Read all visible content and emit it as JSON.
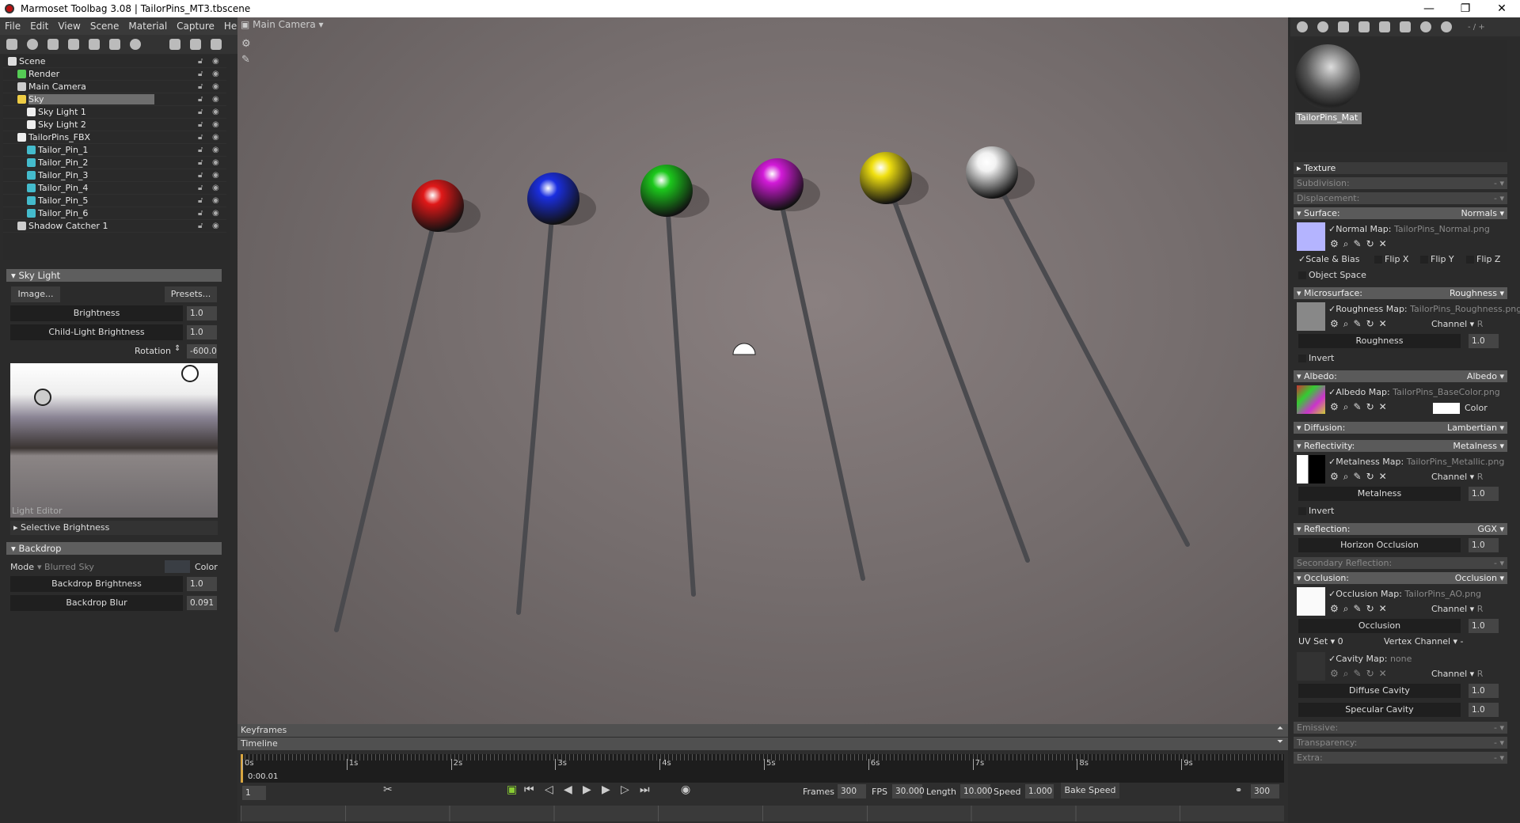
{
  "window": {
    "title": "Marmoset Toolbag 3.08  |  TailorPins_MT3.tbscene",
    "minimize": "—",
    "maximize": "❐",
    "close": "✕"
  },
  "menu": [
    "File",
    "Edit",
    "View",
    "Scene",
    "Material",
    "Capture",
    "Help"
  ],
  "scene_tree": [
    {
      "label": "Scene",
      "icon": "scene-icon",
      "depth": 0
    },
    {
      "label": "Render",
      "icon": "render-gear-icon",
      "depth": 1
    },
    {
      "label": "Main Camera",
      "icon": "camera-icon",
      "depth": 1
    },
    {
      "label": "Sky",
      "icon": "sky-icon",
      "depth": 1,
      "selected": true
    },
    {
      "label": "Sky Light 1",
      "icon": "light-bulb-icon",
      "depth": 2
    },
    {
      "label": "Sky Light 2",
      "icon": "light-bulb-icon",
      "depth": 2
    },
    {
      "label": "TailorPins_FBX",
      "icon": "fbx-icon",
      "depth": 1
    },
    {
      "label": "Tailor_Pin_1",
      "icon": "mesh-cube-icon",
      "depth": 2
    },
    {
      "label": "Tailor_Pin_2",
      "icon": "mesh-cube-icon",
      "depth": 2
    },
    {
      "label": "Tailor_Pin_3",
      "icon": "mesh-cube-icon",
      "depth": 2
    },
    {
      "label": "Tailor_Pin_4",
      "icon": "mesh-cube-icon",
      "depth": 2
    },
    {
      "label": "Tailor_Pin_5",
      "icon": "mesh-cube-icon",
      "depth": 2
    },
    {
      "label": "Tailor_Pin_6",
      "icon": "mesh-cube-icon",
      "depth": 2
    },
    {
      "label": "Shadow Catcher 1",
      "icon": "shadow-catcher-icon",
      "depth": 1
    }
  ],
  "sky_light": {
    "header": "Sky Light",
    "image_btn": "Image...",
    "presets_btn": "Presets...",
    "brightness_label": "Brightness",
    "brightness": "1.0",
    "child_label": "Child-Light Brightness",
    "child": "1.0",
    "rotation_label": "Rotation",
    "rotation": "-600.0",
    "light_editor": "Light Editor",
    "selective": "Selective Brightness"
  },
  "backdrop": {
    "header": "Backdrop",
    "mode_label": "Mode",
    "mode": "Blurred Sky",
    "color_label": "Color",
    "brightness_label": "Backdrop Brightness",
    "brightness": "1.0",
    "blur_label": "Backdrop Blur",
    "blur": "0.091"
  },
  "viewport": {
    "camera": "Main Camera",
    "pin_colors": [
      "#e01818",
      "#1a2ee0",
      "#1cc81c",
      "#d21ad8",
      "#f0e010",
      "#f2f2f2"
    ]
  },
  "timeline": {
    "keyframes": "Keyframes",
    "timeline": "Timeline",
    "ticks": [
      "0s",
      "1s",
      "2s",
      "3s",
      "4s",
      "5s",
      "6s",
      "7s",
      "8s",
      "9s"
    ],
    "current_time": "0:00.01",
    "frame": "1",
    "frames_label": "Frames",
    "frames": "300",
    "fps_label": "FPS",
    "fps": "30.000",
    "length_label": "Length",
    "length": "10.000",
    "speed_label": "Speed",
    "speed": "1.000",
    "bake": "Bake Speed",
    "end_frame": "300"
  },
  "material": {
    "name": "TailorPins_Mat",
    "page": "- / +",
    "texture": "Texture",
    "subdivision": "Subdivision:",
    "displacement": "Displacement:",
    "dash": "-",
    "surface": {
      "h": "Surface:",
      "mode": "Normals",
      "map_label": "Normal Map:",
      "file": "TailorPins_Normal.png",
      "scale_bias": "Scale & Bias",
      "flipx": "Flip X",
      "flipy": "Flip Y",
      "flipz": "Flip Z",
      "object_space": "Object Space"
    },
    "micro": {
      "h": "Microsurface:",
      "mode": "Roughness",
      "map_label": "Roughness Map:",
      "file": "TailorPins_Roughness.png",
      "channel": "Channel",
      "ch": "R",
      "slider": "Roughness",
      "val": "1.0",
      "invert": "Invert"
    },
    "albedo": {
      "h": "Albedo:",
      "mode": "Albedo",
      "map_label": "Albedo Map:",
      "file": "TailorPins_BaseColor.png",
      "color": "Color"
    },
    "diffusion": {
      "h": "Diffusion:",
      "mode": "Lambertian"
    },
    "reflectivity": {
      "h": "Reflectivity:",
      "mode": "Metalness",
      "map_label": "Metalness Map:",
      "file": "TailorPins_Metallic.png",
      "channel": "Channel",
      "ch": "R",
      "slider": "Metalness",
      "val": "1.0",
      "invert": "Invert"
    },
    "reflection": {
      "h": "Reflection:",
      "mode": "GGX",
      "slider": "Horizon Occlusion",
      "val": "1.0"
    },
    "secondary": "Secondary Reflection:",
    "occlusion": {
      "h": "Occlusion:",
      "mode": "Occlusion",
      "map_label": "Occlusion Map:",
      "file": "TailorPins_AO.png",
      "channel": "Channel",
      "ch": "R",
      "slider": "Occlusion",
      "val": "1.0",
      "uvset": "UV Set",
      "uv": "0",
      "vertex": "Vertex Channel",
      "vc": "-",
      "cavity_label": "Cavity Map:",
      "cavity": "none",
      "diffuse": "Diffuse Cavity",
      "dval": "1.0",
      "specular": "Specular Cavity",
      "sval": "1.0"
    },
    "emissive": "Emissive:",
    "transparency": "Transparency:",
    "extra": "Extra:"
  }
}
